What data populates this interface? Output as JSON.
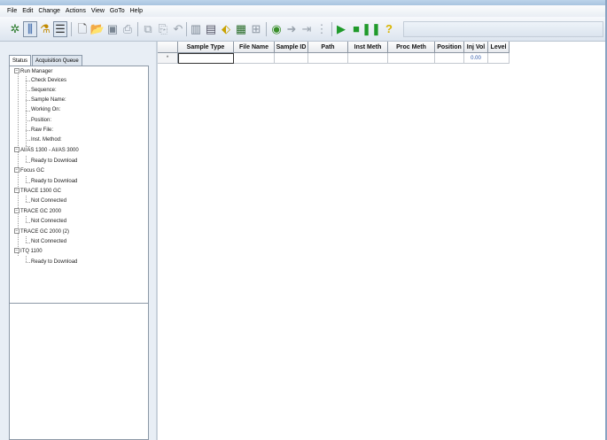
{
  "menu": [
    "File",
    "Edit",
    "Change",
    "Actions",
    "View",
    "GoTo",
    "Help"
  ],
  "toolbar": {
    "icons": [
      "run-manager-icon",
      "instrument-status-icon",
      "instrument-setup-icon",
      "sample-list-icon",
      "new-icon",
      "open-icon",
      "save-icon",
      "print-icon",
      "copy-icon",
      "paste-icon",
      "undo-icon",
      "columns-icon",
      "report-icon",
      "tag-icon",
      "barcode-icon",
      "insert-row-icon",
      "start-queue-icon",
      "forward-icon",
      "backward-icon",
      "sequence-icon",
      "play-icon",
      "stop-icon",
      "pause-icon",
      "help-icon"
    ]
  },
  "tabs": [
    "Status",
    "Acquisition Queue"
  ],
  "tree": [
    {
      "label": "Run Manager",
      "level": 0,
      "expander": "−"
    },
    {
      "label": "Check Devices",
      "level": 1
    },
    {
      "label": "Sequence:",
      "level": 1
    },
    {
      "label": "Sample Name:",
      "level": 1
    },
    {
      "label": "Working On:",
      "level": 1
    },
    {
      "label": "Position:",
      "level": 1
    },
    {
      "label": "Raw File:",
      "level": 1
    },
    {
      "label": "Inst. Method:",
      "level": 1
    },
    {
      "label": "AI/AS 1300 - AI/AS 3000",
      "level": 0,
      "expander": "−"
    },
    {
      "label": "Ready to Download",
      "level": 1
    },
    {
      "label": "Focus GC",
      "level": 0,
      "expander": "−"
    },
    {
      "label": "Ready to Download",
      "level": 1
    },
    {
      "label": "TRACE 1300 GC",
      "level": 0,
      "expander": "−"
    },
    {
      "label": "Not Connected",
      "level": 1
    },
    {
      "label": "TRACE GC 2000",
      "level": 0,
      "expander": "−"
    },
    {
      "label": "Not Connected",
      "level": 1
    },
    {
      "label": "TRACE GC 2000 (2)",
      "level": 0,
      "expander": "−"
    },
    {
      "label": "Not Connected",
      "level": 1
    },
    {
      "label": "ITQ 1100",
      "level": 0,
      "expander": "−"
    },
    {
      "label": "Ready to Download",
      "level": 1
    }
  ],
  "grid": {
    "columns": [
      "",
      "Sample Type",
      "File Name",
      "Sample ID",
      "Path",
      "Inst Meth",
      "Proc Meth",
      "Position",
      "Inj Vol",
      "Level"
    ],
    "new_row_marker": "*",
    "row": [
      "",
      "",
      "",
      "",
      "",
      "",
      "",
      "",
      "0.00",
      ""
    ]
  }
}
